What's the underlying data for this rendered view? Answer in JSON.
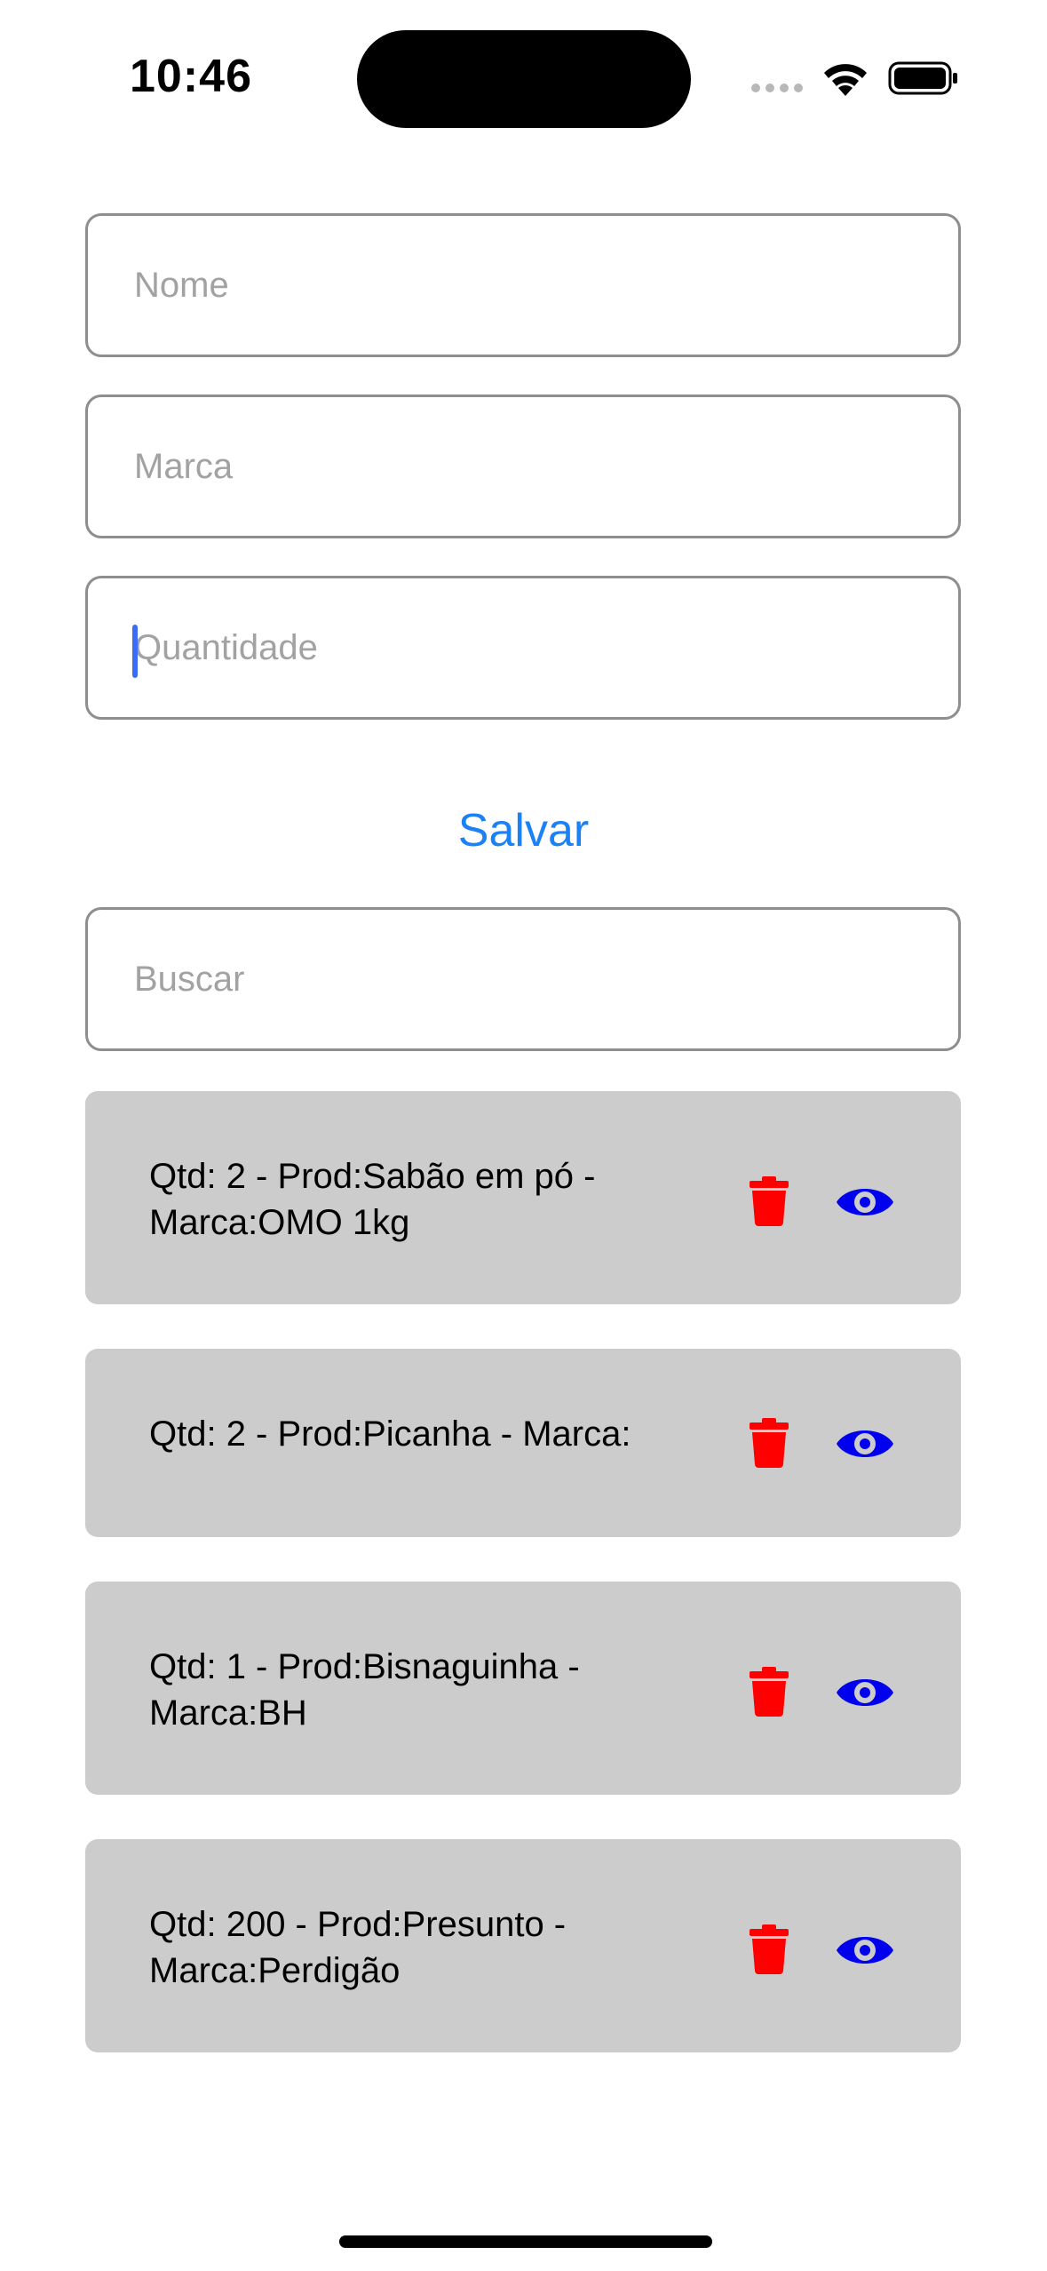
{
  "status_bar": {
    "time": "10:46"
  },
  "form": {
    "name_placeholder": "Nome",
    "brand_placeholder": "Marca",
    "quantity_placeholder": "Quantidade",
    "save_label": "Salvar",
    "search_placeholder": "Buscar"
  },
  "products": [
    {
      "text": "Qtd: 2 - Prod:Sabão em pó - Marca:OMO 1kg"
    },
    {
      "text": "Qtd: 2 - Prod:Picanha - Marca:"
    },
    {
      "text": "Qtd: 1 - Prod:Bisnaguinha - Marca:BH"
    },
    {
      "text": "Qtd: 200 - Prod:Presunto - Marca:Perdigão"
    }
  ],
  "icons": {
    "delete": "trash-icon",
    "view": "eye-icon"
  },
  "colors": {
    "accent": "#1a82f6",
    "delete": "#ff0000",
    "view": "#0000ee",
    "card_background": "#cccccc"
  }
}
